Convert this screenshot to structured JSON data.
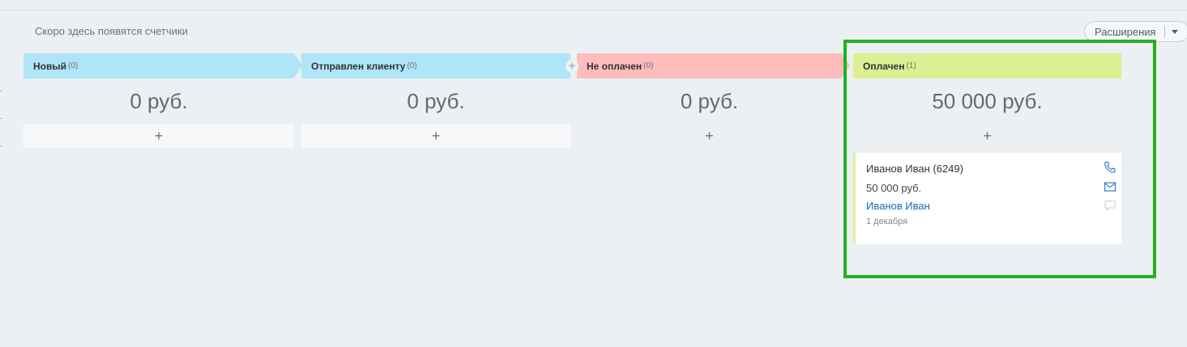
{
  "counters_note": "Скоро здесь появятся счетчики",
  "extensions_button": "Расширения",
  "left_dots": [
    ".",
    ".",
    "."
  ],
  "columns": [
    {
      "title": "Новый",
      "count": "(0)",
      "sum": "0 руб.",
      "add": "+",
      "color": "#aee6f8"
    },
    {
      "title": "Отправлен клиенту",
      "count": "(0)",
      "sum": "0 руб.",
      "add": "+",
      "color": "#aee6f8",
      "add_stage": "+"
    },
    {
      "title": "Не оплачен",
      "count": "(0)",
      "sum": "0 руб.",
      "add": "+",
      "color": "#ffbcbc"
    },
    {
      "title": "Оплачен",
      "count": "(1)",
      "sum": "50 000 руб.",
      "add": "+",
      "color": "#dcef93"
    }
  ],
  "card": {
    "title": "Иванов Иван (6249)",
    "sum": "50 000 руб.",
    "client": "Иванов Иван",
    "date": "1 декабря",
    "icons": [
      "phone-icon",
      "mail-icon",
      "chat-icon"
    ]
  },
  "highlight_color": "#1db31d"
}
